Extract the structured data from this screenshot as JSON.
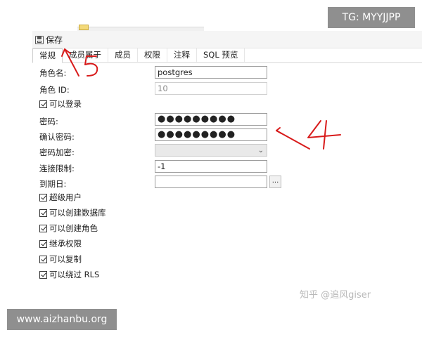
{
  "toolbar": {
    "save_label": "保存"
  },
  "tabs": [
    {
      "label": "常规",
      "active": true
    },
    {
      "label": "成员属于",
      "active": false
    },
    {
      "label": "成员",
      "active": false
    },
    {
      "label": "权限",
      "active": false
    },
    {
      "label": "注释",
      "active": false
    },
    {
      "label": "SQL 预览",
      "active": false
    }
  ],
  "form": {
    "role_name_label": "角色名:",
    "role_name_value": "postgres",
    "role_id_label": "角色 ID:",
    "role_id_value": "10",
    "can_login_label": "可以登录",
    "password_label": "密码:",
    "password_value": "●●●●●●●●●",
    "confirm_password_label": "确认密码:",
    "confirm_password_value": "●●●●●●●●●",
    "encryption_label": "密码加密:",
    "encryption_value": "",
    "connection_limit_label": "连接限制:",
    "connection_limit_value": "-1",
    "expiry_label": "到期日:",
    "expiry_value": "",
    "expiry_button": "...",
    "checkboxes": [
      {
        "label": "超级用户",
        "checked": true
      },
      {
        "label": "可以创建数据库",
        "checked": true
      },
      {
        "label": "可以创建角色",
        "checked": true
      },
      {
        "label": "继承权限",
        "checked": true
      },
      {
        "label": "可以复制",
        "checked": true
      },
      {
        "label": "可以绕过 RLS",
        "checked": true
      }
    ]
  },
  "watermarks": {
    "tg": "TG: MYYJJPP",
    "site": "www.aizhanbu.org",
    "zhihu": "知乎 @追风giser"
  },
  "annotations": {
    "mark_5": "5",
    "mark_4": "4",
    "color": "#d81b1b"
  },
  "icons": {
    "save": "save-disk-icon",
    "dropdown": "chevron-down-icon"
  }
}
